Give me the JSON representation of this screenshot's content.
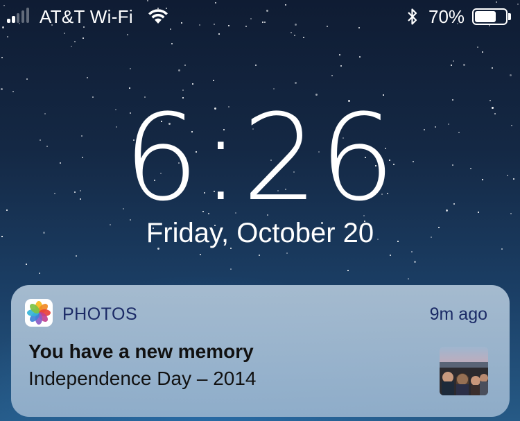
{
  "status_bar": {
    "carrier": "AT&T Wi-Fi",
    "signal_icon": "cellular-signal-icon",
    "signal_bars_total": 5,
    "signal_bars_filled": 2,
    "wifi_icon": "wifi-icon",
    "bluetooth_icon": "bluetooth-icon",
    "battery_percent_label": "70%",
    "battery_level": 0.7
  },
  "lock_screen": {
    "time": "6:26",
    "date": "Friday, October 20"
  },
  "notification": {
    "app_icon": "photos-app-icon",
    "app_name": "PHOTOS",
    "time_ago": "9m ago",
    "title": "You have a new memory",
    "body": "Independence Day – 2014",
    "thumbnail": "memory-photo-thumbnail"
  },
  "colors": {
    "notification_text_accent": "#1b2a66",
    "wallpaper_top": "#0f1c33",
    "wallpaper_bottom": "#265a86"
  }
}
